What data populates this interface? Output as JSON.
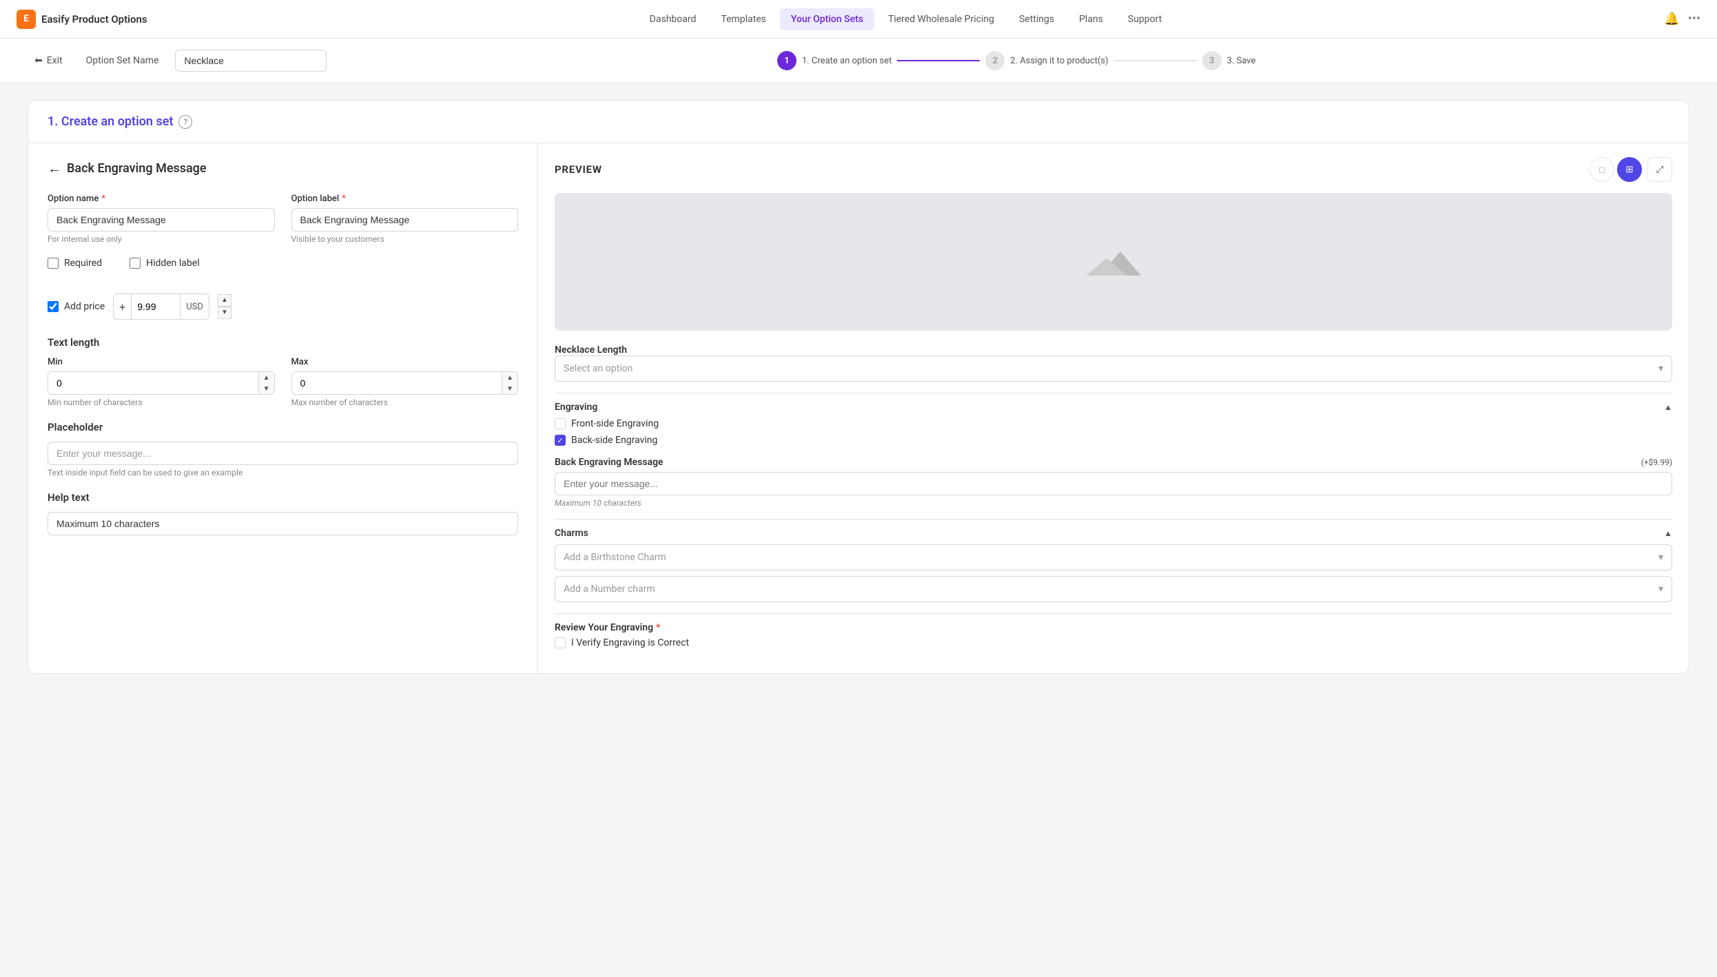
{
  "app": {
    "name": "Easify Product Options",
    "logo_letter": "E"
  },
  "nav": {
    "items": [
      {
        "label": "Dashboard",
        "active": false
      },
      {
        "label": "Templates",
        "active": false
      },
      {
        "label": "Your Option Sets",
        "active": true
      },
      {
        "label": "Tiered Wholesale Pricing",
        "active": false
      },
      {
        "label": "Settings",
        "active": false
      },
      {
        "label": "Plans",
        "active": false
      },
      {
        "label": "Support",
        "active": false
      }
    ]
  },
  "wizard": {
    "exit_label": "Exit",
    "option_set_label": "Option Set Name",
    "option_set_value": "Necklace",
    "steps": [
      {
        "number": "1",
        "label": "1. Create an option set",
        "active": true
      },
      {
        "number": "2",
        "label": "2. Assign it to product(s)",
        "active": false
      },
      {
        "number": "3",
        "label": "3. Save",
        "active": false
      }
    ]
  },
  "card_title": "1. Create an option set",
  "left_panel": {
    "back_title": "Back Engraving Message",
    "option_name_label": "Option name",
    "option_name_value": "Back Engraving Message",
    "option_name_hint": "For internal use only",
    "option_label_label": "Option label",
    "option_label_value": "Back Engraving Message",
    "option_label_hint": "Visible to your customers",
    "required_label": "Required",
    "hidden_label": "Hidden label",
    "add_price_label": "Add price",
    "price_value": "9.99",
    "price_currency": "USD",
    "text_length_title": "Text length",
    "min_label": "Min",
    "min_value": "0",
    "min_hint": "Min number of characters",
    "max_label": "Max",
    "max_value": "0",
    "max_hint": "Max number of characters",
    "placeholder_title": "Placeholder",
    "placeholder_value": "Enter your message...",
    "placeholder_hint": "Text inside input field can be used to give an example",
    "help_text_title": "Help text",
    "help_text_value": "Maximum 10 characters"
  },
  "right_panel": {
    "title": "PREVIEW",
    "necklace_length_label": "Necklace Length",
    "select_placeholder": "Select an option",
    "engraving_label": "Engraving",
    "front_side_label": "Front-side Engraving",
    "back_side_label": "Back-side Engraving",
    "back_engraving_label": "Back Engraving Message",
    "price_badge": "(+$9.99)",
    "engraving_placeholder": "Enter your message...",
    "max_chars_text": "Maximum 10 characters",
    "charms_label": "Charms",
    "birthstone_placeholder": "Add a Birthstone Charm",
    "number_charm_placeholder": "Add a Number charm",
    "review_label": "Review Your Engraving",
    "verify_label": "I Verify Engraving is Correct"
  }
}
